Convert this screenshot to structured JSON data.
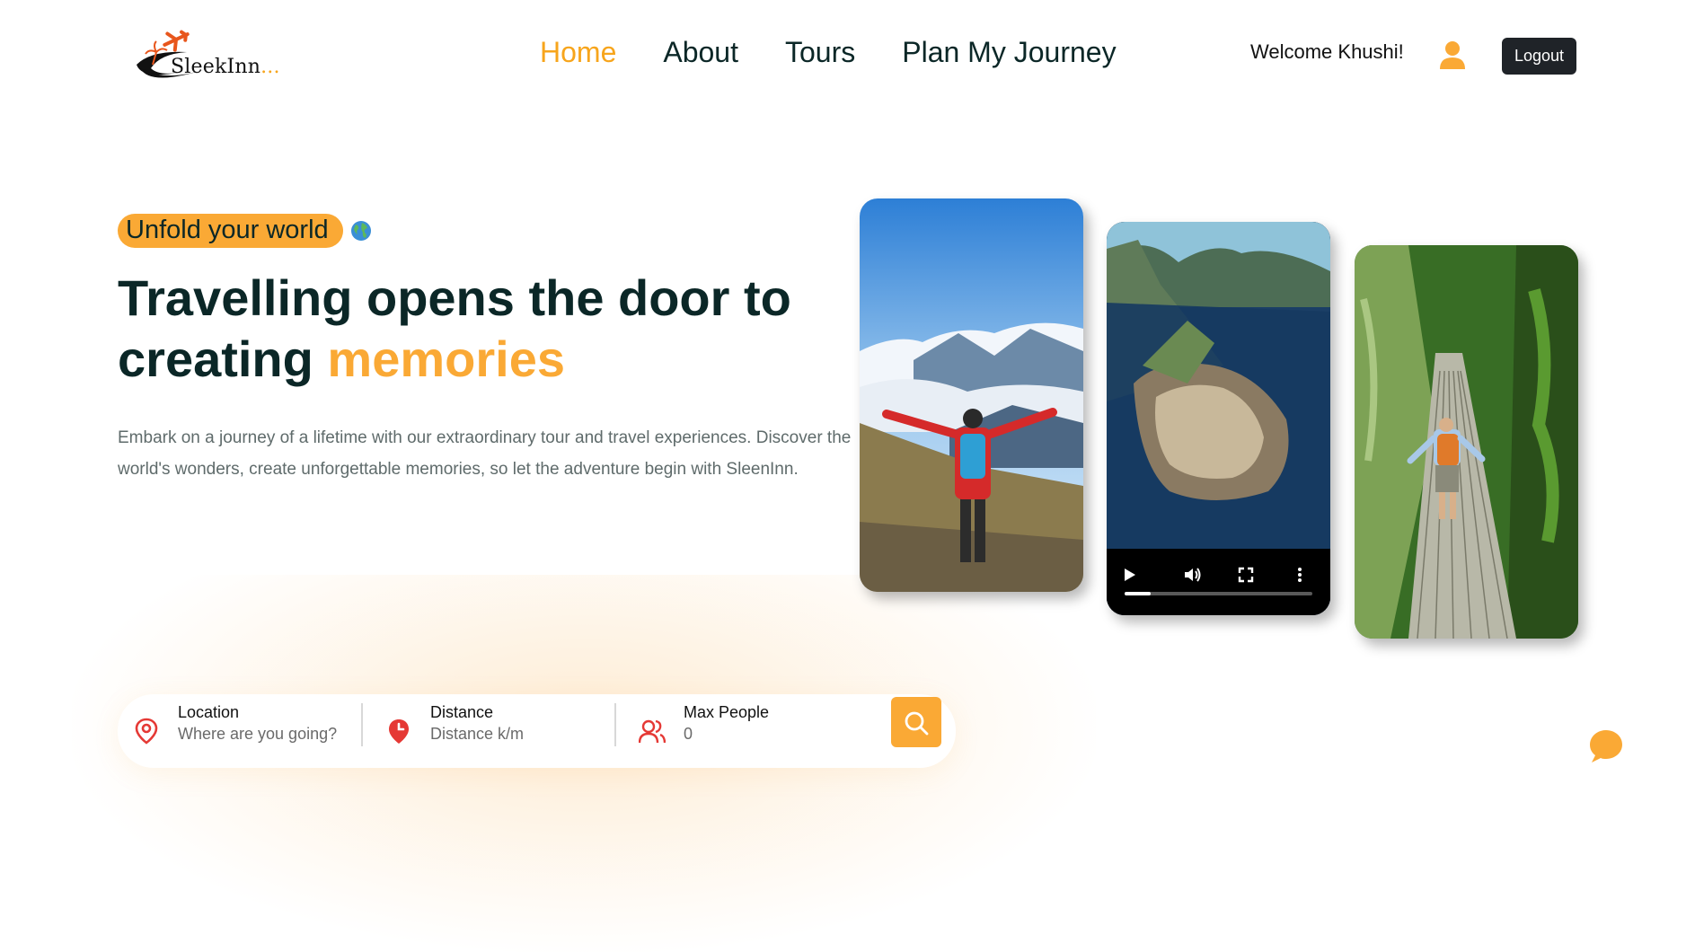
{
  "header": {
    "logo_text": "SleekInn",
    "logo_dots": "...",
    "nav": [
      {
        "label": "Home",
        "active": true
      },
      {
        "label": "About",
        "active": false
      },
      {
        "label": "Tours",
        "active": false
      },
      {
        "label": "Plan My Journey",
        "active": false
      }
    ],
    "welcome": "Welcome Khushi!",
    "logout_label": "Logout"
  },
  "hero": {
    "subtitle": "Unfold your world",
    "headline_part1": "Travelling opens the door to creating",
    "headline_highlight": "memories",
    "description": "Embark on a journey of a lifetime with our extraordinary tour and travel experiences. Discover the world's wonders, create unforgettable memories, so let the adventure begin with SleenInn."
  },
  "media": {
    "video_progress": 0.14
  },
  "search": {
    "location": {
      "label": "Location",
      "placeholder": "Where are you going?"
    },
    "distance": {
      "label": "Distance",
      "placeholder": "Distance k/m"
    },
    "max_people": {
      "label": "Max People",
      "placeholder": "0"
    }
  },
  "colors": {
    "accent": "#faa935",
    "heading": "#0b2727",
    "icon_red": "#e53935",
    "logout_bg": "#1f2328"
  },
  "icons": [
    "airplane-icon",
    "palm-tree-icon",
    "user-icon",
    "globe-icon",
    "play-icon",
    "volume-icon",
    "fullscreen-icon",
    "more-vertical-icon",
    "location-pin-icon",
    "clock-pin-icon",
    "users-icon",
    "search-icon",
    "chat-icon"
  ]
}
